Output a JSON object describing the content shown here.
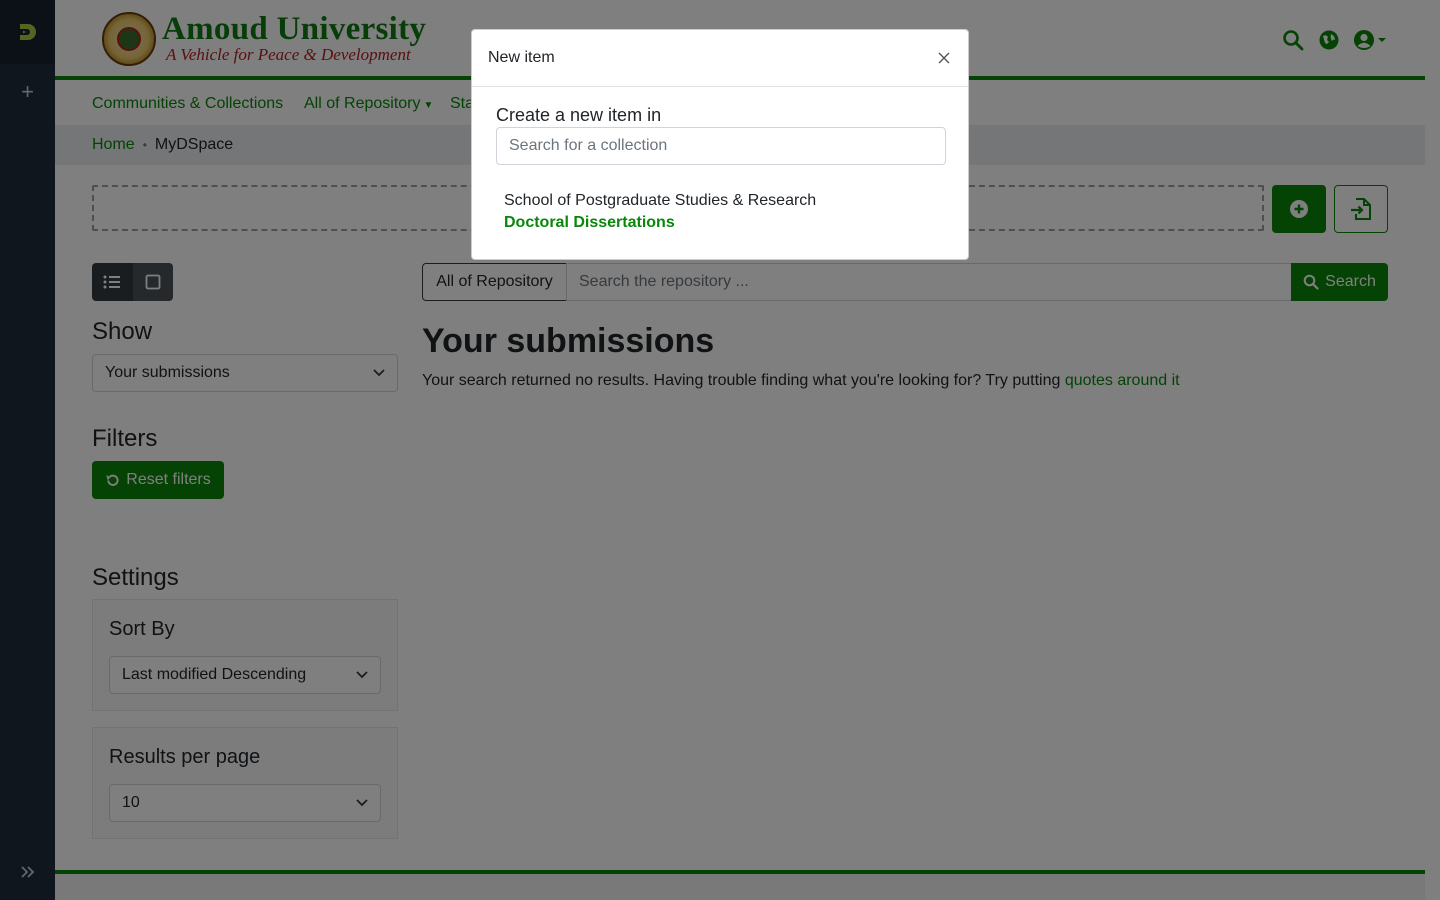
{
  "header": {
    "logo_title": "Amoud University",
    "logo_tagline": "A Vehicle for Peace & Development"
  },
  "nav": {
    "items": [
      {
        "label": "Communities & Collections"
      },
      {
        "label": "All of Repository"
      },
      {
        "label": "Sta"
      }
    ]
  },
  "breadcrumb": {
    "home": "Home",
    "separator": "•",
    "current": "MyDSpace"
  },
  "view_toggle": {
    "list_icon": "list-icon",
    "grid_icon": "grid-icon"
  },
  "sidebar": {
    "show_heading": "Show",
    "show_value": "Your submissions",
    "filters_heading": "Filters",
    "reset_filters_label": "Reset filters",
    "settings_heading": "Settings",
    "sort_by_heading": "Sort By",
    "sort_by_value": "Last modified Descending",
    "results_per_page_heading": "Results per page",
    "results_per_page_value": "10"
  },
  "search": {
    "scope_label": "All of Repository",
    "placeholder": "Search the repository ...",
    "button_label": "Search"
  },
  "results": {
    "title": "Your submissions",
    "message": "Your search returned no results. Having trouble finding what you're looking for? Try putting ",
    "link": "quotes around it"
  },
  "modal": {
    "title": "New item",
    "heading": "Create a new item in",
    "search_placeholder": "Search for a collection",
    "result_parent": "School of Postgraduate Studies & Research",
    "result_name": "Doctoral Dissertations"
  },
  "colors": {
    "brand_green": "#0a870a",
    "admin_sidebar": "#1e2c3b",
    "tagline_red": "#b02020"
  }
}
